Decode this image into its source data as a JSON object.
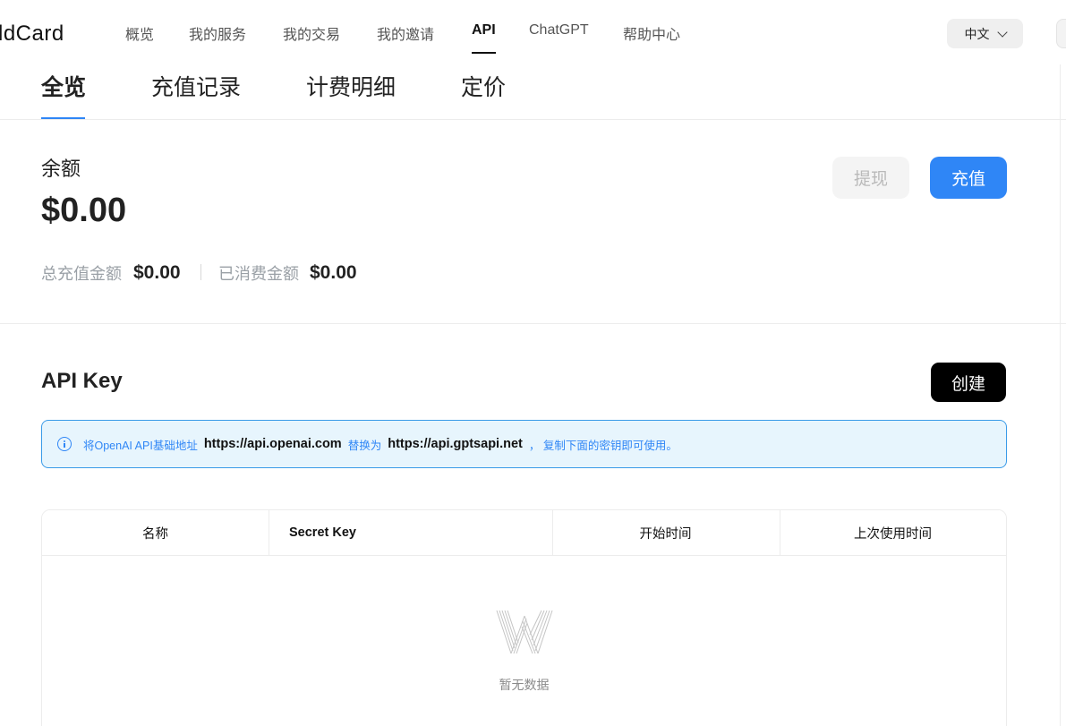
{
  "app": {
    "logo_text": "ldCard"
  },
  "nav": {
    "items": [
      {
        "label": "概览"
      },
      {
        "label": "我的服务"
      },
      {
        "label": "我的交易"
      },
      {
        "label": "我的邀请"
      },
      {
        "label": "API"
      },
      {
        "label": "ChatGPT"
      },
      {
        "label": "帮助中心"
      }
    ],
    "active_index": 4,
    "language": "中文"
  },
  "tabs": {
    "items": [
      {
        "label": "全览"
      },
      {
        "label": "充值记录"
      },
      {
        "label": "计费明细"
      },
      {
        "label": "定价"
      }
    ],
    "active_index": 0
  },
  "balance": {
    "label": "余额",
    "value": "$0.00",
    "total_recharge_label": "总充值金额",
    "total_recharge_value": "$0.00",
    "consumed_label": "已消费金额",
    "consumed_value": "$0.00",
    "withdraw_label": "提现",
    "recharge_label": "充值"
  },
  "api_key": {
    "title": "API Key",
    "create_label": "创建",
    "info": {
      "part1": "将OpenAI API基础地址",
      "url_original": "https://api.openai.com",
      "part2": "替换为",
      "url_new": "https://api.gptsapi.net",
      "part3": "， 复制下面的密钥即可使用。"
    },
    "table": {
      "columns": [
        {
          "label": "名称"
        },
        {
          "label": "Secret Key"
        },
        {
          "label": "开始时间"
        },
        {
          "label": "上次使用时间"
        }
      ],
      "empty_text": "暂无数据"
    }
  },
  "colors": {
    "accent": "#2f86f6",
    "info_bg": "#e7f5fd",
    "create_button": "#000000"
  }
}
